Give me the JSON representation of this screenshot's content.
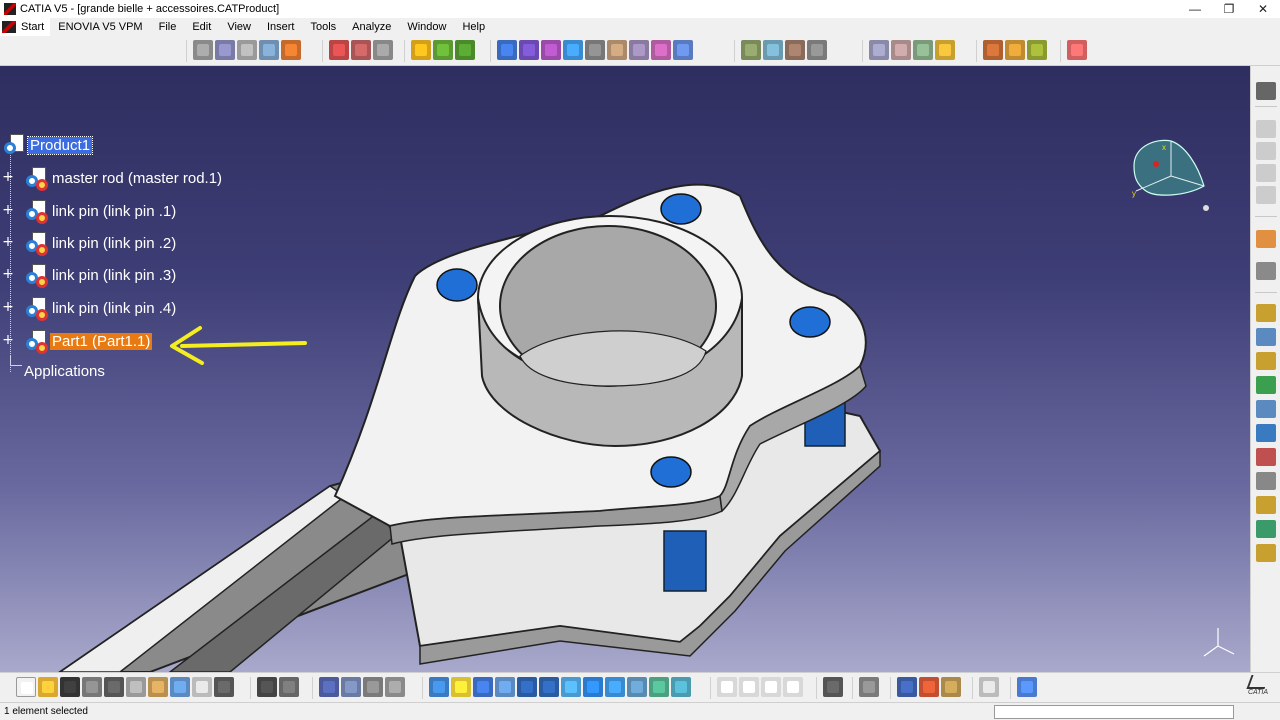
{
  "window": {
    "title": "CATIA V5 - [grande bielle + accessoires.CATProduct]",
    "minimize_glyph": "—",
    "maximize_glyph": "❐",
    "close_glyph": "✕"
  },
  "menu": {
    "start": "Start",
    "items": [
      "ENOVIA V5 VPM",
      "File",
      "Edit",
      "View",
      "Insert",
      "Tools",
      "Analyze",
      "Window",
      "Help"
    ]
  },
  "tree": {
    "root": "Product1",
    "children": [
      "master rod (master rod.1)",
      "link pin  (link pin .1)",
      "link pin  (link pin .2)",
      "link pin  (link pin .3)",
      "link pin  (link pin .4)",
      "Part1 (Part1.1)"
    ],
    "applications": "Applications",
    "expand_glyph": "+"
  },
  "annotation": {
    "arrow_color": "#f5ee1e",
    "highlight_color": "#e97a12",
    "root_selection_color": "#3c6ce0"
  },
  "compass": {
    "x_label": "x",
    "y_label": "y"
  },
  "status": {
    "text": "1 element selected"
  },
  "brand": {
    "logo_text": "CATIA"
  },
  "colors": {
    "part_face": "#f2f2f2",
    "pin_blue": "#1f6fd6",
    "background_top": "#2e2e60",
    "background_bottom": "#a9a9cc"
  }
}
